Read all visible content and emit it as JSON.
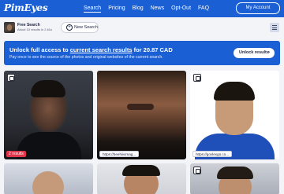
{
  "header": {
    "logo": "PimEyes",
    "nav": [
      {
        "label": "Search"
      },
      {
        "label": "Pricing"
      },
      {
        "label": "Blog"
      },
      {
        "label": "News"
      },
      {
        "label": "Opt-Out"
      },
      {
        "label": "FAQ"
      }
    ],
    "account_label": "My Account"
  },
  "search_bar": {
    "status_title": "Free Search",
    "status_sub": "About 10 results in 2.61s",
    "new_search_label": "New Search"
  },
  "banner": {
    "title_prefix": "Unlock full access to ",
    "title_link": "current search results",
    "title_suffix": " for 20.87 CAD",
    "subtitle": "Pay once to see the source of the photos and original websites of the current search.",
    "button_label": "Unlock results"
  },
  "results": [
    {
      "tag": "2 results"
    },
    {
      "tag": "https://beehiivimag..."
    },
    {
      "tag": "https://govlexgo.co..."
    }
  ],
  "colors": {
    "brand": "#1a5fd4",
    "background": "#f2f4f8",
    "badge_red": "#e0354a"
  }
}
